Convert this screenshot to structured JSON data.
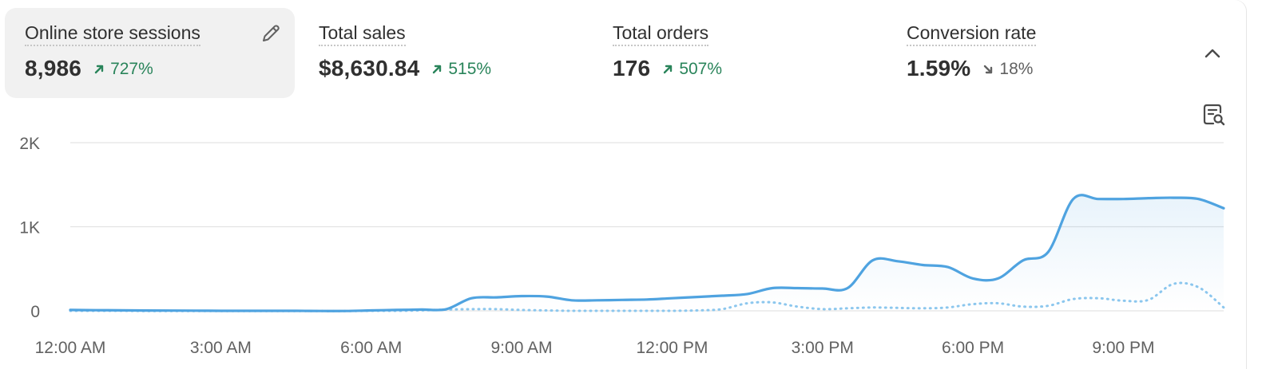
{
  "metrics": [
    {
      "title": "Online store sessions",
      "value": "8,986",
      "change": "727%",
      "direction": "up",
      "selected": true
    },
    {
      "title": "Total sales",
      "value": "$8,630.84",
      "change": "515%",
      "direction": "up",
      "selected": false
    },
    {
      "title": "Total orders",
      "value": "176",
      "change": "507%",
      "direction": "up",
      "selected": false
    },
    {
      "title": "Conversion rate",
      "value": "1.59%",
      "change": "18%",
      "direction": "down",
      "selected": false
    }
  ],
  "icons": {
    "edit": "pencil-icon",
    "collapse": "chevron-up-icon",
    "report": "report-search-icon"
  },
  "colors": {
    "primary_line": "#4fa3e0",
    "comparison_line": "#8cc7ee",
    "positive": "#29845a",
    "negative": "#616161"
  },
  "chart_data": {
    "type": "line",
    "y_tick_labels": [
      "0",
      "1K",
      "2K"
    ],
    "y_ticks": [
      0,
      1000,
      2000
    ],
    "ylim": [
      0,
      2000
    ],
    "xlim": [
      0,
      23
    ],
    "x_tick_labels": [
      "12:00 AM",
      "3:00 AM",
      "6:00 AM",
      "9:00 AM",
      "12:00 PM",
      "3:00 PM",
      "6:00 PM",
      "9:00 PM"
    ],
    "x_ticks": [
      0,
      3,
      6,
      9,
      12,
      15,
      18,
      21
    ],
    "grid": true,
    "series": [
      {
        "style": "solid",
        "x": [
          0,
          0.5,
          1,
          1.5,
          2,
          2.5,
          3,
          3.5,
          4,
          4.5,
          5,
          5.5,
          6,
          6.5,
          7,
          7.5,
          8,
          8.5,
          9,
          9.5,
          10,
          10.5,
          11,
          11.5,
          12,
          12.5,
          13,
          13.5,
          14,
          14.5,
          15,
          15.5,
          16,
          16.5,
          17,
          17.5,
          18,
          18.5,
          19,
          19.5,
          20,
          20.5,
          21,
          21.5,
          22,
          22.5,
          23
        ],
        "values": [
          10,
          8,
          6,
          4,
          3,
          2,
          0,
          0,
          0,
          0,
          -2,
          -2,
          5,
          10,
          15,
          20,
          150,
          160,
          175,
          170,
          125,
          125,
          130,
          135,
          150,
          165,
          180,
          200,
          270,
          270,
          265,
          270,
          600,
          590,
          545,
          520,
          385,
          385,
          600,
          700,
          1330,
          1330,
          1330,
          1340,
          1345,
          1330,
          1220
        ]
      },
      {
        "style": "dotted",
        "x": [
          0,
          0.5,
          1,
          1.5,
          2,
          2.5,
          3,
          3.5,
          4,
          4.5,
          5,
          5.5,
          6,
          6.5,
          7,
          7.5,
          8,
          8.5,
          9,
          9.5,
          10,
          10.5,
          11,
          11.5,
          12,
          12.5,
          13,
          13.5,
          14,
          14.5,
          15,
          15.5,
          16,
          16.5,
          17,
          17.5,
          18,
          18.5,
          19,
          19.5,
          20,
          20.5,
          21,
          21.5,
          22,
          22.5,
          23
        ],
        "values": [
          0,
          0,
          0,
          -2,
          -2,
          -3,
          -3,
          -3,
          -3,
          -3,
          -3,
          -3,
          0,
          0,
          5,
          15,
          20,
          20,
          10,
          5,
          0,
          0,
          0,
          0,
          0,
          5,
          20,
          90,
          100,
          50,
          20,
          30,
          40,
          35,
          30,
          40,
          80,
          90,
          50,
          60,
          140,
          150,
          120,
          130,
          320,
          280,
          40
        ]
      }
    ]
  }
}
